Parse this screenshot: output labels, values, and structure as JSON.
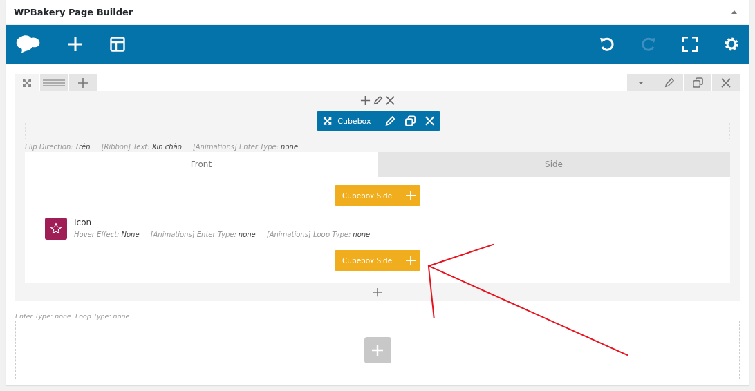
{
  "panel": {
    "title": "WPBakery Page Builder",
    "collapsed": false
  },
  "row": {
    "element": {
      "title": "Cubebox",
      "params": [
        {
          "label": "Flip Direction:",
          "value": "Trên"
        },
        {
          "label": "[Ribbon] Text:",
          "value": "Xin chào"
        },
        {
          "label": "[Animations] Enter Type:",
          "value": "none"
        }
      ],
      "tabs": [
        {
          "label": "Front",
          "selected": true
        },
        {
          "label": "Side",
          "selected": false
        }
      ],
      "items": [
        {
          "kind": "add",
          "label": "Cubebox Side"
        },
        {
          "kind": "icon",
          "title": "Icon",
          "params": [
            {
              "label": "Hover Effect:",
              "value": "None"
            },
            {
              "label": "[Animations] Enter Type:",
              "value": "none"
            },
            {
              "label": "[Animations] Loop Type:",
              "value": "none"
            }
          ]
        },
        {
          "kind": "add",
          "label": "Cubebox Side"
        }
      ]
    }
  },
  "row_params": "Enter Type: none  Loop Type: none"
}
